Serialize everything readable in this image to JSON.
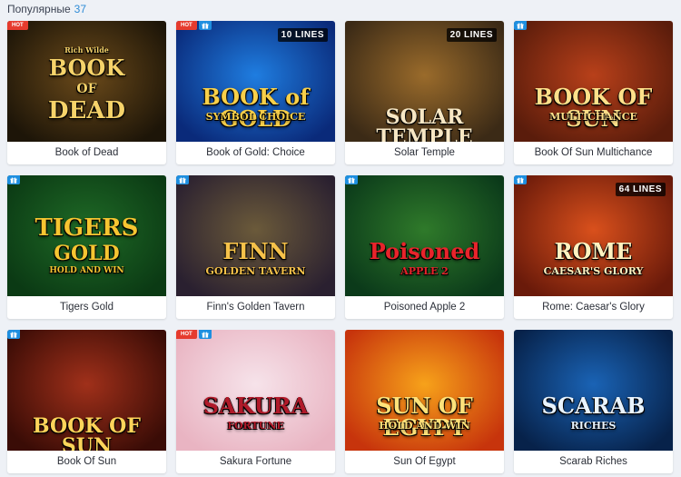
{
  "header": {
    "title": "Популярные",
    "count": "37"
  },
  "games": [
    {
      "name": "Book of Dead",
      "hot": true,
      "gift": false,
      "lines": "",
      "art": {
        "line1": "Rich Wilde",
        "line2": "BOOK",
        "line3": "OF",
        "line4": "DEAD"
      },
      "colors": {
        "bg1": "#1d1508",
        "bg2": "#6b4a1a",
        "text": "#f6d36a"
      }
    },
    {
      "name": "Book of Gold: Choice",
      "hot": true,
      "gift": true,
      "lines": "10 LINES",
      "art": {
        "line1": "BOOK of GOLD",
        "line2": "SYMBOL CHOICE"
      },
      "colors": {
        "bg1": "#0a2a7a",
        "bg2": "#1f7de0",
        "text": "#f8d04a"
      }
    },
    {
      "name": "Solar Temple",
      "hot": false,
      "gift": false,
      "lines": "20 LINES",
      "art": {
        "line1": "SOLAR TEMPLE"
      },
      "colors": {
        "bg1": "#3b2a16",
        "bg2": "#9a6b2b",
        "text": "#f7e7c4"
      }
    },
    {
      "name": "Book Of Sun Multichance",
      "hot": false,
      "gift": true,
      "lines": "",
      "art": {
        "line1": "BOOK OF SUN",
        "line2": "MULTICHANCE"
      },
      "colors": {
        "bg1": "#5a1c0b",
        "bg2": "#b8401a",
        "text": "#ffe08a"
      }
    },
    {
      "name": "Tigers Gold",
      "hot": false,
      "gift": true,
      "lines": "",
      "art": {
        "line1": "TIGERS",
        "line2": "GOLD",
        "line3": "HOLD AND WIN"
      },
      "colors": {
        "bg1": "#0b3a14",
        "bg2": "#1f6a26",
        "text": "#f6c531"
      }
    },
    {
      "name": "Finn's Golden Tavern",
      "hot": false,
      "gift": true,
      "lines": "",
      "art": {
        "line1": "FINN",
        "line2": "GOLDEN TAVERN"
      },
      "colors": {
        "bg1": "#2a2030",
        "bg2": "#6b5a3a",
        "text": "#f6c24a"
      }
    },
    {
      "name": "Poisoned Apple 2",
      "hot": false,
      "gift": true,
      "lines": "",
      "art": {
        "line1": "Poisoned",
        "line2": "APPLE 2"
      },
      "colors": {
        "bg1": "#0b3a1a",
        "bg2": "#2f7a2a",
        "text": "#e8242b"
      }
    },
    {
      "name": "Rome: Caesar's Glory",
      "hot": false,
      "gift": true,
      "lines": "64 LINES",
      "art": {
        "line1": "ROME",
        "line2": "CAESAR'S GLORY"
      },
      "colors": {
        "bg1": "#6a1a0a",
        "bg2": "#d9501c",
        "text": "#fff2c0"
      }
    },
    {
      "name": "Book Of Sun",
      "hot": false,
      "gift": true,
      "lines": "",
      "art": {
        "line1": "BOOK OF SUN"
      },
      "colors": {
        "bg1": "#3a0c06",
        "bg2": "#a0301a",
        "text": "#ffd45a"
      }
    },
    {
      "name": "Sakura Fortune",
      "hot": true,
      "gift": true,
      "lines": "",
      "art": {
        "line1": "SAKURA",
        "line2": "FORTUNE"
      },
      "colors": {
        "bg1": "#e9b4c2",
        "bg2": "#f6e3ea",
        "text": "#b01a2a"
      }
    },
    {
      "name": "Sun Of Egypt",
      "hot": false,
      "gift": false,
      "lines": "",
      "art": {
        "line1": "SUN OF EGYPT",
        "line2": "HOLD AND WIN"
      },
      "colors": {
        "bg1": "#c7340c",
        "bg2": "#f7a21a",
        "text": "#ffe27a"
      }
    },
    {
      "name": "Scarab Riches",
      "hot": false,
      "gift": false,
      "lines": "",
      "art": {
        "line1": "SCARAB",
        "line2": "RICHES"
      },
      "colors": {
        "bg1": "#07224a",
        "bg2": "#1a63b5",
        "text": "#e9f4ff"
      }
    }
  ],
  "badge_labels": {
    "hot": "HOT"
  },
  "icons": {
    "gift": "gift-icon"
  }
}
